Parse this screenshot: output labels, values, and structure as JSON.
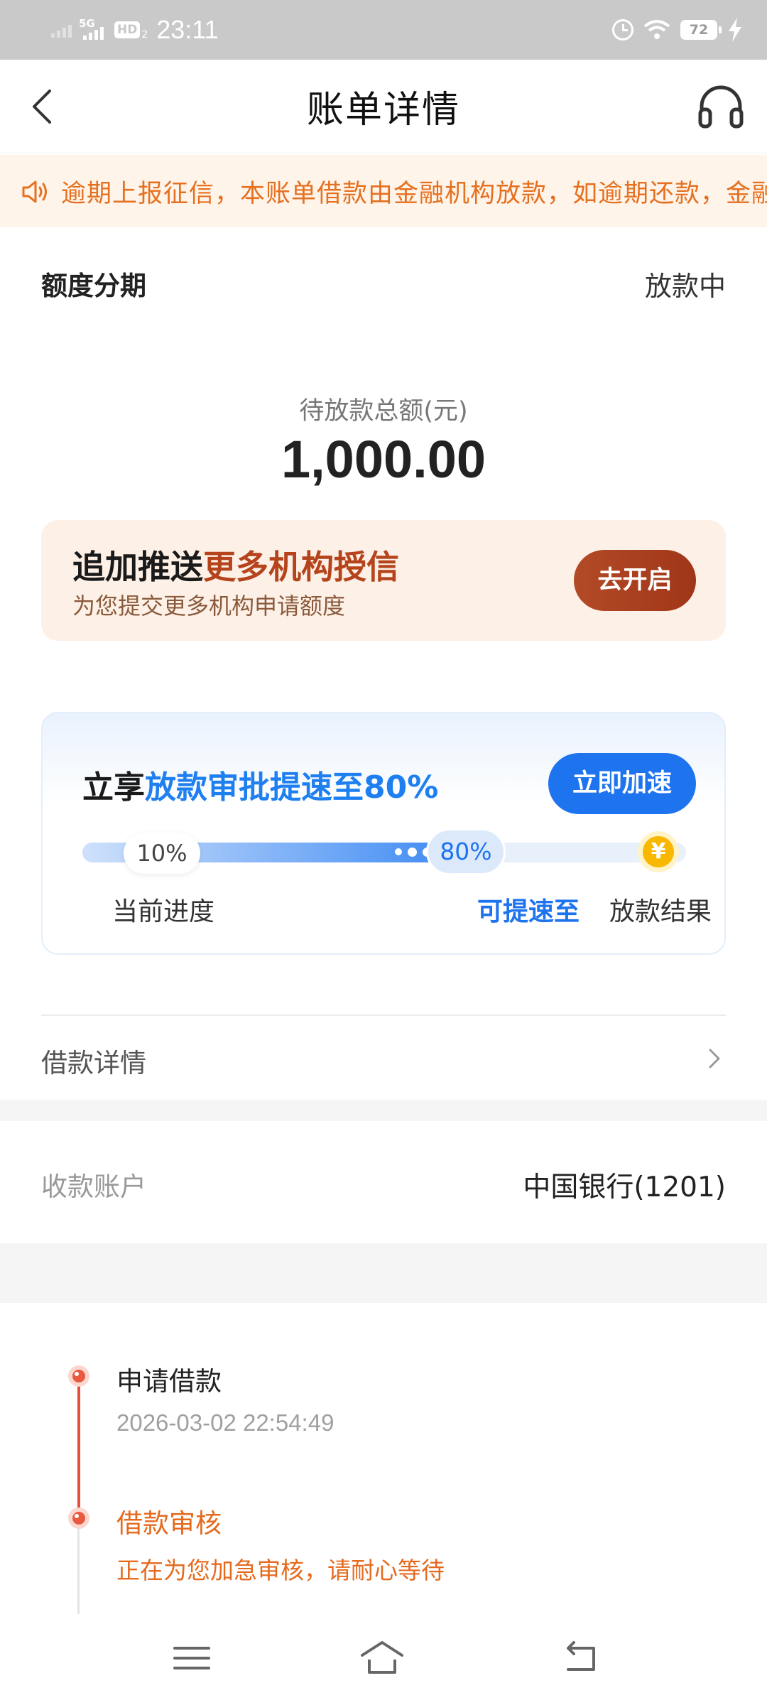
{
  "status_bar": {
    "network": "5G",
    "hd_label": "HD",
    "hd_sub": "2",
    "time": "23:11",
    "battery": "72"
  },
  "header": {
    "title": "账单详情"
  },
  "notice": {
    "text": "逾期上报征信，本账单借款由金融机构放款，如逾期还款，金融机构"
  },
  "bill": {
    "product": "额度分期",
    "status": "放款中",
    "amount_label": "待放款总额(元)",
    "amount": "1,000.00"
  },
  "promo": {
    "title_plain": "追加推送",
    "title_highlight": "更多机构授信",
    "subtitle": "为您提交更多机构申请额度",
    "button": "去开启"
  },
  "speedup": {
    "title_plain": "立享",
    "title_highlight": "放款审批提速至80%",
    "button": "立即加速",
    "current_progress": 10,
    "current_label": "10%",
    "target_progress": 80,
    "target_label": "80%",
    "coin_symbol": "¥",
    "step_current": "当前进度",
    "step_target": "可提速至",
    "step_result": "放款结果"
  },
  "loan_detail": {
    "label": "借款详情"
  },
  "account": {
    "label": "收款账户",
    "value": "中国银行(1201)"
  },
  "timeline": [
    {
      "title": "申请借款",
      "time": "2026-03-02 22:54:49"
    },
    {
      "title": "借款审核",
      "desc": "正在为您加急审核，请耐心等待"
    }
  ],
  "colors": {
    "accent_blue": "#1e74ef",
    "accent_orange": "#e56a1e",
    "promo_brown": "#b5431c",
    "timeline_red": "#e84c3d"
  },
  "icons": [
    "back-arrow-icon",
    "headset-icon",
    "speaker-icon",
    "chevron-right-icon",
    "coin-icon",
    "menu-icon",
    "home-icon",
    "back-nav-icon"
  ]
}
